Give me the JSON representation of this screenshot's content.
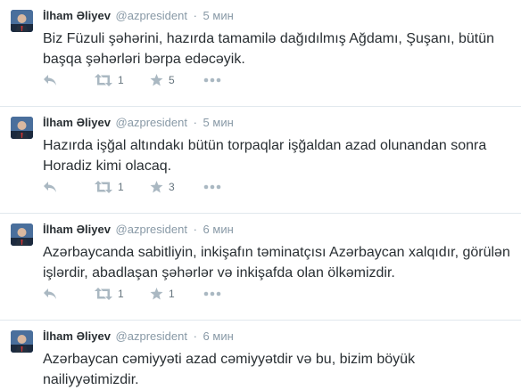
{
  "tweets": [
    {
      "fullname": "İlham Əliyev",
      "username": "@azpresident",
      "separator": "·",
      "time": "5 мин",
      "text": "Biz Füzuli şəhərini, hazırda tamamilə dağıdılmış Ağdamı, Şuşanı, bütün başqa şəhərləri bərpa edəcəyik.",
      "retweets": "1",
      "favorites": "5"
    },
    {
      "fullname": "İlham Əliyev",
      "username": "@azpresident",
      "separator": "·",
      "time": "5 мин",
      "text": "Hazırda işğal altındakı bütün torpaqlar işğaldan azad olunandan sonra Horadiz kimi olacaq.",
      "retweets": "1",
      "favorites": "3"
    },
    {
      "fullname": "İlham Əliyev",
      "username": "@azpresident",
      "separator": "·",
      "time": "6 мин",
      "text": "Azərbaycanda sabitliyin, inkişafın təminatçısı Azərbaycan xalqıdır, görülən işlərdir, abadlaşan şəhərlər və inkişafda olan ölkəmizdir.",
      "retweets": "1",
      "favorites": "1"
    },
    {
      "fullname": "İlham Əliyev",
      "username": "@azpresident",
      "separator": "·",
      "time": "6 мин",
      "text": "Azərbaycan cəmiyyəti azad cəmiyyətdir və bu, bizim böyük nailiyyətimizdir."
    }
  ],
  "icons": {
    "reply": "reply-arrow-icon",
    "retweet": "retweet-icon",
    "favorite": "star-icon",
    "more": "ellipsis-icon"
  },
  "colors": {
    "text": "#292f33",
    "muted": "#8899a6",
    "icon": "#aab8c2",
    "divider": "#e1e8ed"
  }
}
